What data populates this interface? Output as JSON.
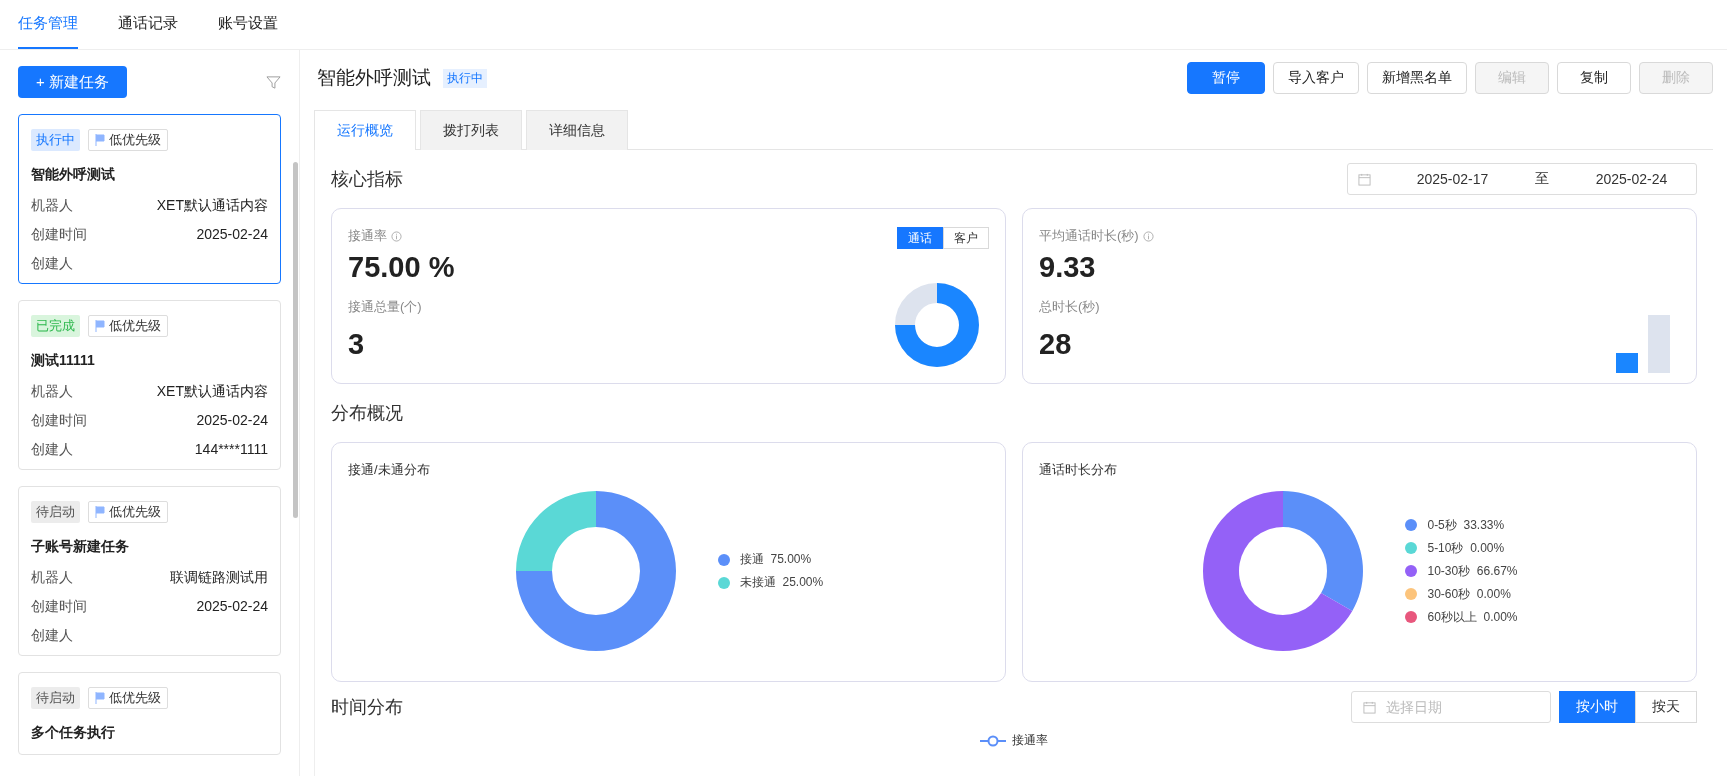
{
  "nav_tabs": [
    {
      "label": "任务管理",
      "selected": true
    },
    {
      "label": "通话记录",
      "selected": false
    },
    {
      "label": "账号设置",
      "selected": false
    }
  ],
  "sidebar": {
    "new_button": "+ 新建任务",
    "tasks": [
      {
        "status": "执行中",
        "kind": "running",
        "priority": "低优先级",
        "title": "智能外呼测试",
        "selected": true,
        "fields": [
          {
            "label": "机器人",
            "value": "XET默认通话内容"
          },
          {
            "label": "创建时间",
            "value": "2025-02-24"
          },
          {
            "label": "创建人"
          }
        ]
      },
      {
        "status": "已完成",
        "kind": "done",
        "priority": "低优先级",
        "title": "测试11111",
        "selected": false,
        "fields": [
          {
            "label": "机器人",
            "value": "XET默认通话内容"
          },
          {
            "label": "创建时间",
            "value": "2025-02-24"
          },
          {
            "label": "创建人",
            "value": "144****1111"
          }
        ]
      },
      {
        "status": "待启动",
        "kind": "pending",
        "priority": "低优先级",
        "title": "子账号新建任务",
        "selected": false,
        "fields": [
          {
            "label": "机器人",
            "value": "联调链路测试用"
          },
          {
            "label": "创建时间",
            "value": "2025-02-24"
          },
          {
            "label": "创建人"
          }
        ]
      },
      {
        "status": "待启动",
        "kind": "pending",
        "priority": "低优先级",
        "title": "多个任务执行",
        "selected": false
      }
    ]
  },
  "header": {
    "title": "智能外呼测试",
    "status": "执行中",
    "buttons": [
      {
        "label": "暂停",
        "kind": "primary",
        "disabled": false
      },
      {
        "label": "导入客户",
        "kind": "default",
        "disabled": false
      },
      {
        "label": "新增黑名单",
        "kind": "default",
        "disabled": false
      },
      {
        "label": "编辑",
        "kind": "default",
        "disabled": true
      },
      {
        "label": "复制",
        "kind": "default",
        "disabled": false
      },
      {
        "label": "删除",
        "kind": "default",
        "disabled": true
      }
    ]
  },
  "tabs": [
    {
      "label": "运行概览",
      "selected": true
    },
    {
      "label": "拨打列表",
      "selected": false
    },
    {
      "label": "详细信息",
      "selected": false
    }
  ],
  "core": {
    "title": "核心指标",
    "date_range": {
      "start": "2025-02-17",
      "separator": "至",
      "end": "2025-02-24"
    },
    "rate_card": {
      "label": "接通率",
      "value": "75.00 %",
      "toggle": [
        {
          "label": "通话",
          "selected": true
        },
        {
          "label": "客户",
          "selected": false
        }
      ],
      "sub_label": "接通总量(个)",
      "sub_value": "3"
    },
    "duration_card": {
      "label": "平均通话时长(秒)",
      "value": "9.33",
      "sub_label": "总时长(秒)",
      "sub_value": "28"
    }
  },
  "distribution": {
    "title": "分布概况",
    "charts": [
      {
        "title": "接通/未通分布",
        "chart_data": {
          "type": "donut",
          "categories": [
            "接通",
            "未接通"
          ],
          "values": [
            75,
            25
          ],
          "value_labels": [
            "75.00%",
            "25.00%"
          ]
        }
      },
      {
        "title": "通话时长分布",
        "chart_data": {
          "type": "donut",
          "categories": [
            "0-5秒",
            "5-10秒",
            "10-30秒",
            "30-60秒",
            "60秒以上"
          ],
          "values": [
            33.33,
            0,
            66.67,
            0,
            0
          ],
          "value_labels": [
            "33.33%",
            "0.00%",
            "66.67%",
            "0.00%",
            "0.00%"
          ]
        }
      }
    ]
  },
  "time": {
    "title": "时间分布",
    "date_placeholder": "选择日期",
    "toggle": [
      {
        "label": "按小时",
        "selected": true
      },
      {
        "label": "按天",
        "selected": false
      }
    ],
    "legend": "接通率"
  }
}
